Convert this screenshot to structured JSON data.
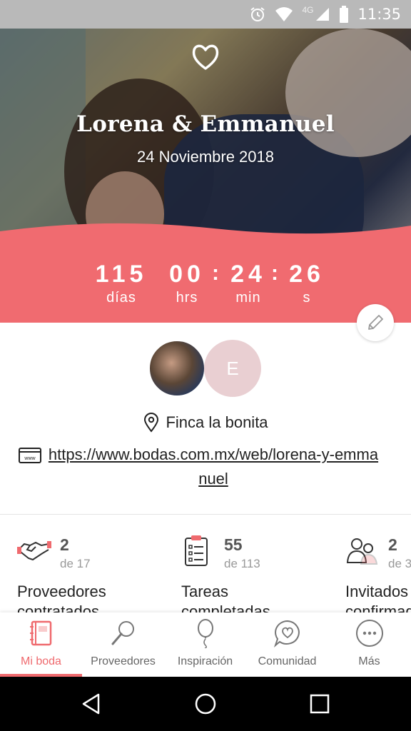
{
  "status_bar": {
    "network": "4G",
    "time": "11:35"
  },
  "hero": {
    "couple_names": "Lorena & Emmanuel",
    "wedding_date": "24 Noviembre 2018"
  },
  "countdown": {
    "days": "115",
    "days_label": "días",
    "hours": "00",
    "hours_label": "hrs",
    "minutes": "24",
    "minutes_label": "min",
    "seconds": "26",
    "seconds_label": "s",
    "separator": ":"
  },
  "profile": {
    "partner_initial": "E",
    "venue": "Finca la bonita",
    "website": "https://www.bodas.com.mx/web/lorena-y-emmanuel"
  },
  "stats": [
    {
      "count": "2",
      "of": "de 17",
      "title": "Proveedores",
      "title2": "contratados",
      "icon": "handshake-icon"
    },
    {
      "count": "55",
      "of": "de 113",
      "title": "Tareas",
      "title2": "completadas",
      "icon": "checklist-icon"
    },
    {
      "count": "2",
      "of": "de 3",
      "title": "Invitados",
      "title2": "confirmados",
      "icon": "guests-icon"
    }
  ],
  "bottom_nav": [
    {
      "label": "Mi boda",
      "icon": "notebook-icon",
      "active": true
    },
    {
      "label": "Proveedores",
      "icon": "magnifier-icon",
      "active": false
    },
    {
      "label": "Inspiración",
      "icon": "balloon-icon",
      "active": false
    },
    {
      "label": "Comunidad",
      "icon": "chat-heart-icon",
      "active": false
    },
    {
      "label": "Más",
      "icon": "more-icon",
      "active": false
    }
  ],
  "colors": {
    "accent": "#ef6a6e",
    "status_bar": "#b9b9b9"
  }
}
